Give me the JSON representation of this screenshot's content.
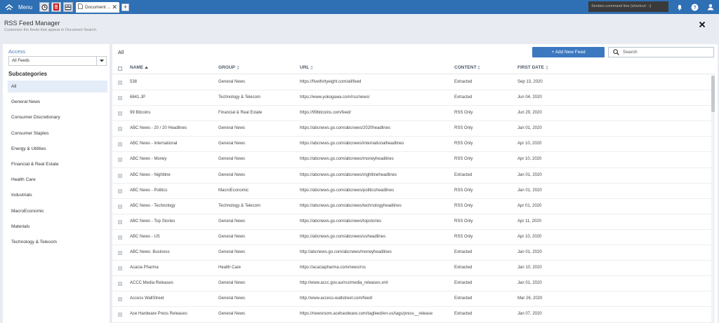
{
  "topbar": {
    "menu_label": "Menu",
    "doc_tab_label": "Document ...",
    "command_placeholder": "Sentieo command line (shortcut: ~)"
  },
  "header": {
    "title": "RSS Feed Manager",
    "subtitle": "Customize the feeds that appear in Document Search."
  },
  "sidebar": {
    "access_label": "Access",
    "access_value": "All Feeds",
    "subcategories_title": "Subcategories",
    "items": [
      {
        "label": "All",
        "active": true
      },
      {
        "label": "General News"
      },
      {
        "label": "Consumer Discretionary"
      },
      {
        "label": "Consumer Staples"
      },
      {
        "label": "Energy & Utilities"
      },
      {
        "label": "Financial & Real Estate"
      },
      {
        "label": "Health Care"
      },
      {
        "label": "Industrials"
      },
      {
        "label": "MacroEconomic"
      },
      {
        "label": "Materials"
      },
      {
        "label": "Technology & Telecom"
      }
    ]
  },
  "main": {
    "crumb": "All",
    "add_button_label": "+ Add New Feed",
    "search_placeholder": "Search",
    "columns": {
      "name": "NAME",
      "group": "GROUP",
      "url": "URL",
      "content": "CONTENT",
      "first_date": "FIRST DATE"
    },
    "rows": [
      {
        "name": "538",
        "group": "General News",
        "url": "https://fivethirtyeight.com/all/feed",
        "content": "Extracted",
        "date": "Sep 13, 2020"
      },
      {
        "name": "6841.JP",
        "group": "Technology & Telecom",
        "url": "https://www.yokogawa.com/rss/news/",
        "content": "Extracted",
        "date": "Jun 04, 2020"
      },
      {
        "name": "99 Bitcoins",
        "group": "Financial & Real Estate",
        "url": "https://99bitcoins.com/feed/",
        "content": "RSS Only",
        "date": "Jun 29, 2020"
      },
      {
        "name": "ABC News - 20 / 20 Headlines",
        "group": "General News",
        "url": "https://abcnews.go.com/abcnews/2020headlines",
        "content": "RSS Only",
        "date": "Jan 01, 2020"
      },
      {
        "name": "ABC News - International",
        "group": "General News",
        "url": "https://abcnews.go.com/abcnews/internationalheadlines",
        "content": "RSS Only",
        "date": "Apr 10, 2020"
      },
      {
        "name": "ABC News - Money",
        "group": "General News",
        "url": "https://abcnews.go.com/abcnews/moneyheadlines",
        "content": "RSS Only",
        "date": "Apr 10, 2020"
      },
      {
        "name": "ABC News - Nightline",
        "group": "General News",
        "url": "https://abcnews.go.com/abcnews/nightlineheadlines",
        "content": "Extracted",
        "date": "Jan 01, 2020"
      },
      {
        "name": "ABC News - Politics",
        "group": "MacroEconomic",
        "url": "https://abcnews.go.com/abcnews/politicsheadlines",
        "content": "RSS Only",
        "date": "Jan 01, 2020"
      },
      {
        "name": "ABC News - Technology",
        "group": "Technology & Telecom",
        "url": "https://abcnews.go.com/abcnews/technologyheadlines",
        "content": "RSS Only",
        "date": "Apr 01, 2020"
      },
      {
        "name": "ABC News - Top Stories",
        "group": "General News",
        "url": "https://abcnews.go.com/abcnews/topstories",
        "content": "RSS Only",
        "date": "Apr 11, 2020"
      },
      {
        "name": "ABC News - US",
        "group": "General News",
        "url": "https://abcnews.go.com/abcnews/usheadlines",
        "content": "RSS Only",
        "date": "Apr 10, 2020"
      },
      {
        "name": "ABC News: Business",
        "group": "General News",
        "url": "http://abcnews.go.com/abcnews/moneyheadlines",
        "content": "Extracted",
        "date": "Jan 01, 2020"
      },
      {
        "name": "Acacia Pharma",
        "group": "Health Care",
        "url": "https://acaciapharma.com/news/rss",
        "content": "Extracted",
        "date": "Jan 10, 2020"
      },
      {
        "name": "ACCC Media Releases",
        "group": "General News",
        "url": "http://www.accc.gov.au/rss/media_releases.xml",
        "content": "Extracted",
        "date": "Jan 01, 2020"
      },
      {
        "name": "Access WallStreet",
        "group": "General News",
        "url": "http://www.access-wallstreet.com/feed/",
        "content": "Extracted",
        "date": "Mar 26, 2020"
      },
      {
        "name": "Ace Hardware Press Releases",
        "group": "General News",
        "url": "https://newsroom.acehardware.com/tagfeed/en-us/tags/press__release",
        "content": "Extracted",
        "date": "Jan 07, 2020"
      }
    ]
  }
}
